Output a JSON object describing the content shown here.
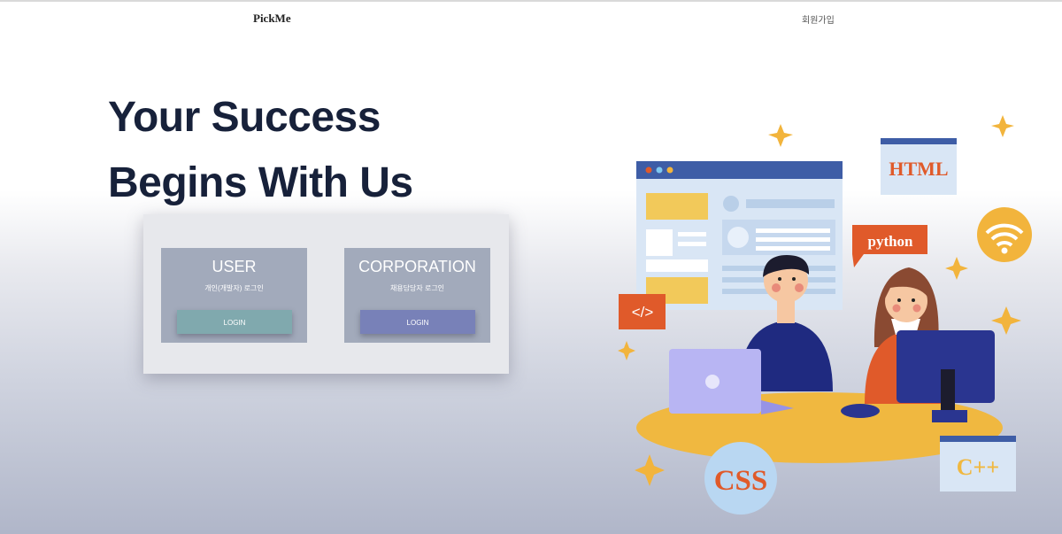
{
  "header": {
    "brand": "PickMe",
    "signup": "회원가입"
  },
  "hero": {
    "line1": "Your Success",
    "line2": "Begins With Us"
  },
  "login": {
    "user": {
      "title": "USER",
      "subtitle": "개인(개발자) 로그인",
      "button": "LOGIN"
    },
    "corporation": {
      "title": "CORPORATION",
      "subtitle": "채용담당자 로그인",
      "button": "LOGIN"
    }
  },
  "illustration": {
    "labels": {
      "html": "HTML",
      "python": "python",
      "css": "CSS",
      "cpp": "C++",
      "code": "</>"
    }
  },
  "colors": {
    "hero_text": "#17213a",
    "user_button": "#80a9ae",
    "corp_button": "#7881b8",
    "accent_orange": "#e05a2a",
    "accent_yellow": "#f2b43c",
    "browser_blue": "#3e5da6"
  }
}
